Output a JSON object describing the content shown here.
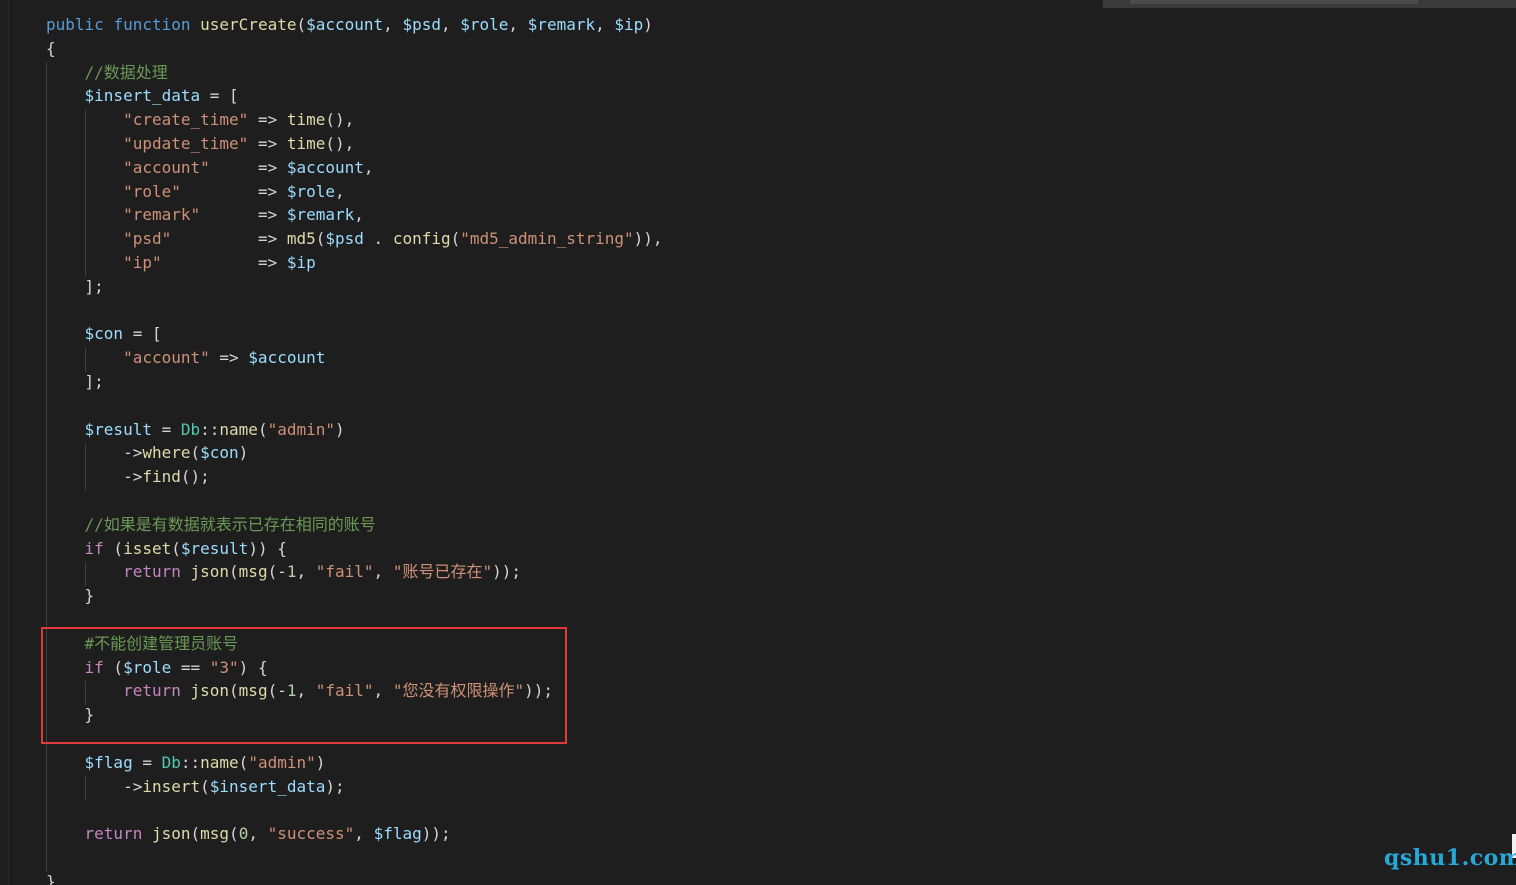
{
  "editor": {
    "code_lines": [
      [
        [
          "keyword",
          "public"
        ],
        [
          "punct",
          " "
        ],
        [
          "keyword",
          "function"
        ],
        [
          "punct",
          " "
        ],
        [
          "function",
          "userCreate"
        ],
        [
          "punct",
          "("
        ],
        [
          "variable",
          "$account"
        ],
        [
          "punct",
          ", "
        ],
        [
          "variable",
          "$psd"
        ],
        [
          "punct",
          ", "
        ],
        [
          "variable",
          "$role"
        ],
        [
          "punct",
          ", "
        ],
        [
          "variable",
          "$remark"
        ],
        [
          "punct",
          ", "
        ],
        [
          "variable",
          "$ip"
        ],
        [
          "punct",
          ")"
        ]
      ],
      [
        [
          "punct",
          "{"
        ]
      ],
      [
        [
          "punct",
          "    "
        ],
        [
          "comment",
          "//数据处理"
        ]
      ],
      [
        [
          "punct",
          "    "
        ],
        [
          "variable",
          "$insert_data"
        ],
        [
          "operator",
          " = "
        ],
        [
          "punct",
          "["
        ]
      ],
      [
        [
          "punct",
          "        "
        ],
        [
          "string",
          "\"create_time\""
        ],
        [
          "operator",
          " => "
        ],
        [
          "function",
          "time"
        ],
        [
          "punct",
          "(),"
        ]
      ],
      [
        [
          "punct",
          "        "
        ],
        [
          "string",
          "\"update_time\""
        ],
        [
          "operator",
          " => "
        ],
        [
          "function",
          "time"
        ],
        [
          "punct",
          "(),"
        ]
      ],
      [
        [
          "punct",
          "        "
        ],
        [
          "string",
          "\"account\""
        ],
        [
          "operator",
          "     => "
        ],
        [
          "variable",
          "$account"
        ],
        [
          "punct",
          ","
        ]
      ],
      [
        [
          "punct",
          "        "
        ],
        [
          "string",
          "\"role\""
        ],
        [
          "operator",
          "        => "
        ],
        [
          "variable",
          "$role"
        ],
        [
          "punct",
          ","
        ]
      ],
      [
        [
          "punct",
          "        "
        ],
        [
          "string",
          "\"remark\""
        ],
        [
          "operator",
          "      => "
        ],
        [
          "variable",
          "$remark"
        ],
        [
          "punct",
          ","
        ]
      ],
      [
        [
          "punct",
          "        "
        ],
        [
          "string",
          "\"psd\""
        ],
        [
          "operator",
          "         => "
        ],
        [
          "function",
          "md5"
        ],
        [
          "punct",
          "("
        ],
        [
          "variable",
          "$psd"
        ],
        [
          "operator",
          " . "
        ],
        [
          "function",
          "config"
        ],
        [
          "punct",
          "("
        ],
        [
          "string",
          "\"md5_admin_string\""
        ],
        [
          "punct",
          ")),"
        ]
      ],
      [
        [
          "punct",
          "        "
        ],
        [
          "string",
          "\"ip\""
        ],
        [
          "operator",
          "          => "
        ],
        [
          "variable",
          "$ip"
        ]
      ],
      [
        [
          "punct",
          "    ];"
        ]
      ],
      [
        [
          "punct",
          ""
        ]
      ],
      [
        [
          "punct",
          "    "
        ],
        [
          "variable",
          "$con"
        ],
        [
          "operator",
          " = "
        ],
        [
          "punct",
          "["
        ]
      ],
      [
        [
          "punct",
          "        "
        ],
        [
          "string",
          "\"account\""
        ],
        [
          "operator",
          " => "
        ],
        [
          "variable",
          "$account"
        ]
      ],
      [
        [
          "punct",
          "    ];"
        ]
      ],
      [
        [
          "punct",
          ""
        ]
      ],
      [
        [
          "punct",
          "    "
        ],
        [
          "variable",
          "$result"
        ],
        [
          "operator",
          " = "
        ],
        [
          "class",
          "Db"
        ],
        [
          "punct",
          "::"
        ],
        [
          "function",
          "name"
        ],
        [
          "punct",
          "("
        ],
        [
          "string",
          "\"admin\""
        ],
        [
          "punct",
          ")"
        ]
      ],
      [
        [
          "punct",
          "        ->"
        ],
        [
          "function",
          "where"
        ],
        [
          "punct",
          "("
        ],
        [
          "variable",
          "$con"
        ],
        [
          "punct",
          ")"
        ]
      ],
      [
        [
          "punct",
          "        ->"
        ],
        [
          "function",
          "find"
        ],
        [
          "punct",
          "();"
        ]
      ],
      [
        [
          "punct",
          ""
        ]
      ],
      [
        [
          "punct",
          "    "
        ],
        [
          "comment",
          "//如果是有数据就表示已存在相同的账号"
        ]
      ],
      [
        [
          "punct",
          "    "
        ],
        [
          "control",
          "if"
        ],
        [
          "punct",
          " ("
        ],
        [
          "function",
          "isset"
        ],
        [
          "punct",
          "("
        ],
        [
          "variable",
          "$result"
        ],
        [
          "punct",
          ")) {"
        ]
      ],
      [
        [
          "punct",
          "        "
        ],
        [
          "control",
          "return"
        ],
        [
          "punct",
          " "
        ],
        [
          "function",
          "json"
        ],
        [
          "punct",
          "("
        ],
        [
          "function",
          "msg"
        ],
        [
          "punct",
          "(-"
        ],
        [
          "number",
          "1"
        ],
        [
          "punct",
          ", "
        ],
        [
          "string",
          "\"fail\""
        ],
        [
          "punct",
          ", "
        ],
        [
          "string",
          "\"账号已存在\""
        ],
        [
          "punct",
          "));"
        ]
      ],
      [
        [
          "punct",
          "    }"
        ]
      ],
      [
        [
          "punct",
          ""
        ]
      ],
      [
        [
          "punct",
          "    "
        ],
        [
          "comment",
          "#不能创建管理员账号"
        ]
      ],
      [
        [
          "punct",
          "    "
        ],
        [
          "control",
          "if"
        ],
        [
          "punct",
          " ("
        ],
        [
          "variable",
          "$role"
        ],
        [
          "operator",
          " == "
        ],
        [
          "string",
          "\"3\""
        ],
        [
          "punct",
          ") {"
        ]
      ],
      [
        [
          "punct",
          "        "
        ],
        [
          "control",
          "return"
        ],
        [
          "punct",
          " "
        ],
        [
          "function",
          "json"
        ],
        [
          "punct",
          "("
        ],
        [
          "function",
          "msg"
        ],
        [
          "punct",
          "(-"
        ],
        [
          "number",
          "1"
        ],
        [
          "punct",
          ", "
        ],
        [
          "string",
          "\"fail\""
        ],
        [
          "punct",
          ", "
        ],
        [
          "string",
          "\"您没有权限操作\""
        ],
        [
          "punct",
          "));"
        ]
      ],
      [
        [
          "punct",
          "    }"
        ]
      ],
      [
        [
          "punct",
          ""
        ]
      ],
      [
        [
          "punct",
          "    "
        ],
        [
          "variable",
          "$flag"
        ],
        [
          "operator",
          " = "
        ],
        [
          "class",
          "Db"
        ],
        [
          "punct",
          "::"
        ],
        [
          "function",
          "name"
        ],
        [
          "punct",
          "("
        ],
        [
          "string",
          "\"admin\""
        ],
        [
          "punct",
          ")"
        ]
      ],
      [
        [
          "punct",
          "        ->"
        ],
        [
          "function",
          "insert"
        ],
        [
          "punct",
          "("
        ],
        [
          "variable",
          "$insert_data"
        ],
        [
          "punct",
          ");"
        ]
      ],
      [
        [
          "punct",
          ""
        ]
      ],
      [
        [
          "punct",
          "    "
        ],
        [
          "control",
          "return"
        ],
        [
          "punct",
          " "
        ],
        [
          "function",
          "json"
        ],
        [
          "punct",
          "("
        ],
        [
          "function",
          "msg"
        ],
        [
          "punct",
          "("
        ],
        [
          "number",
          "0"
        ],
        [
          "punct",
          ", "
        ],
        [
          "string",
          "\"success\""
        ],
        [
          "punct",
          ", "
        ],
        [
          "variable",
          "$flag"
        ],
        [
          "punct",
          "));"
        ]
      ],
      [
        [
          "punct",
          ""
        ]
      ],
      [
        [
          "punct",
          "}"
        ]
      ]
    ]
  },
  "watermark": {
    "text": "qshu1.com"
  },
  "colors": {
    "background": "#1e1e1e",
    "highlight_border": "#e03a3a",
    "watermark": "#28a8d8"
  }
}
